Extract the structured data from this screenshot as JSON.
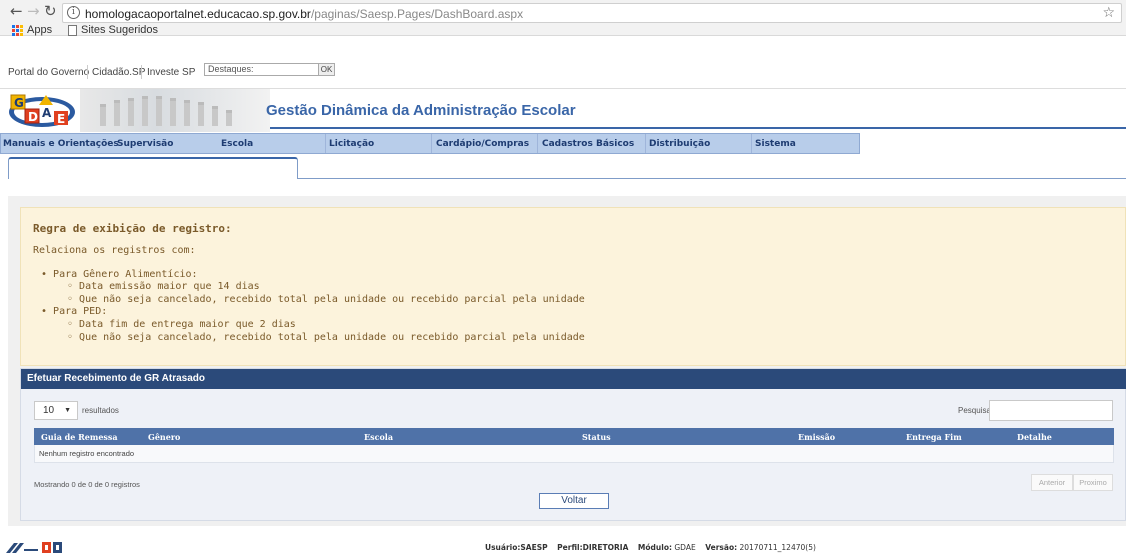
{
  "browser": {
    "url_host": "homologacaoportalnet.educacao.sp.gov.br",
    "url_path": "/paginas/Saesp.Pages/DashBoard.aspx",
    "back_icon": "back-arrow-icon",
    "forward_icon": "forward-arrow-icon",
    "reload_icon": "reload-icon",
    "bookmarks": [
      "Apps",
      "Sites Sugeridos"
    ]
  },
  "gov_bar": {
    "links": [
      "Portal do Governo",
      "Cidadão.SP",
      "Investe SP"
    ],
    "destaques_placeholder": "Destaques:",
    "ok_label": "OK"
  },
  "header": {
    "logo_text": "GDAE",
    "title": "Gestão Dinâmica da Administração Escolar"
  },
  "menu": {
    "items": [
      "Manuais e Orientações",
      "Supervisão",
      "Escola",
      "Licitação",
      "Cardápio/Compras",
      "Cadastros Básicos",
      "Distribuição",
      "Sistema"
    ]
  },
  "rules": {
    "title": "Regra de exibição de registro:",
    "intro": "Relaciona os registros com:",
    "groups": [
      {
        "label": "Para Gênero Alimentício:",
        "items": [
          "Data emissão maior que 14 dias",
          "Que não seja cancelado, recebido total pela unidade ou recebido parcial pela unidade"
        ]
      },
      {
        "label": "Para PED:",
        "items": [
          "Data fim de entrega maior que 2 dias",
          "Que não seja cancelado, recebido total pela unidade ou recebido parcial pela unidade"
        ]
      }
    ]
  },
  "panel": {
    "title": "Efetuar Recebimento de GR Atrasado",
    "length_value": "10",
    "length_label": "resultados",
    "search_label": "Pesquisar",
    "columns": [
      "Guia de Remessa",
      "Gênero",
      "Escola",
      "Status",
      "Emissão",
      "Entrega Fim",
      "Detalhe"
    ],
    "empty_message": "Nenhum registro encontrado",
    "info": "Mostrando 0 de 0 de 0 registros",
    "prev_label": "Anterior",
    "next_label": "Proximo",
    "back_label": "Voltar"
  },
  "footer": {
    "user_label": "Usuário:",
    "user_value": "SAESP",
    "profile_label": "Perfil:",
    "profile_value": "DIRETORIA",
    "module_label": "Módulo:",
    "module_value": "GDAE",
    "version_label": "Versão:",
    "version_value": "20170711_12470(5)"
  }
}
